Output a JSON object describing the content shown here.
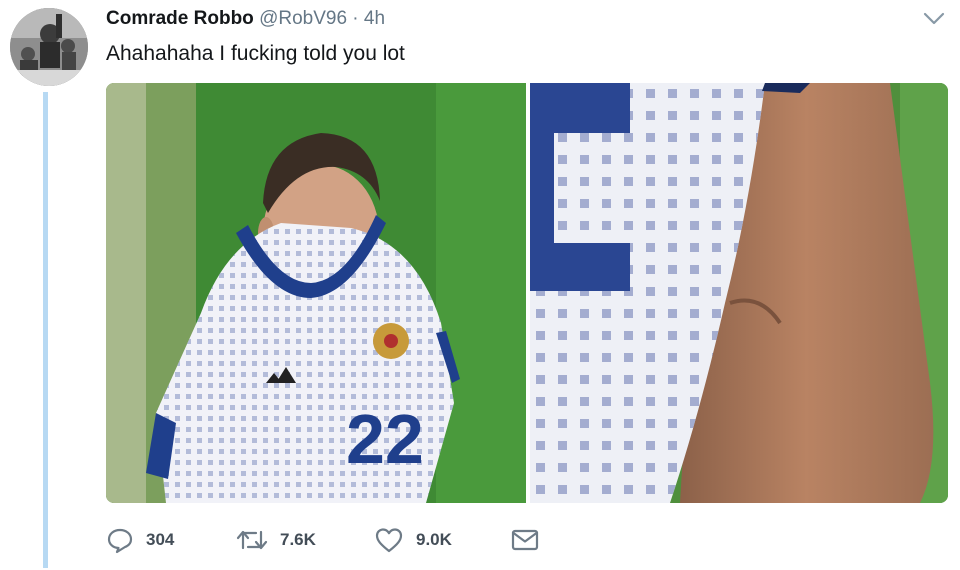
{
  "tweet": {
    "display_name": "Comrade Robbo",
    "handle": "@RobV96",
    "separator": "·",
    "time": "4h",
    "text": "Ahahahaha I fucking told you lot",
    "media": {
      "left": {
        "jersey_number": "22"
      }
    }
  },
  "actions": {
    "reply": {
      "icon": "reply-icon",
      "count": "304"
    },
    "retweet": {
      "icon": "retweet-icon",
      "count": "7.6K"
    },
    "like": {
      "icon": "heart-icon",
      "count": "9.0K"
    },
    "message": {
      "icon": "envelope-icon"
    }
  },
  "colors": {
    "thread_line": "#b7d9f3",
    "icon_gray": "#6e7b87",
    "pitch_green": "#3f8a34",
    "jersey_blue": "#1f3f8c"
  }
}
